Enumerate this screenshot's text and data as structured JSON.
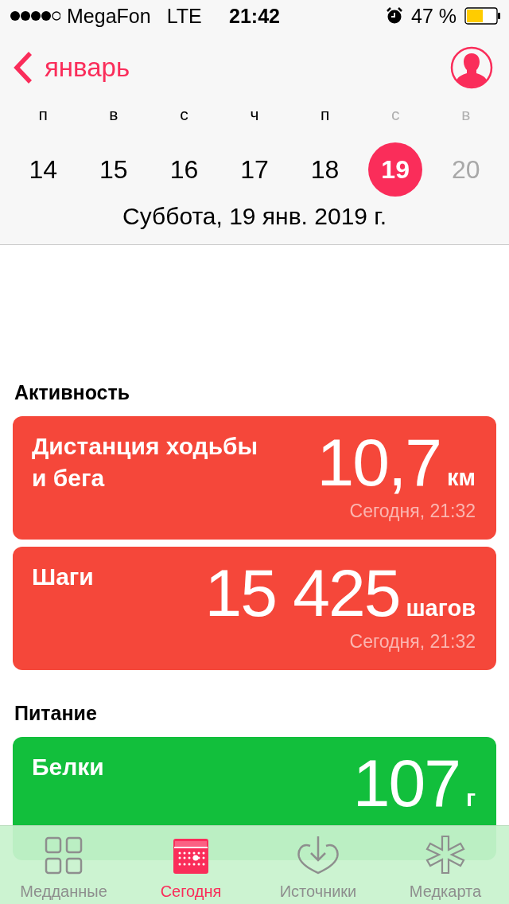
{
  "status_bar": {
    "carrier": "MegaFon",
    "network": "LTE",
    "time": "21:42",
    "battery": "47 %"
  },
  "nav": {
    "back": "январь"
  },
  "week": [
    {
      "letter": "п",
      "day": "14",
      "selected": false,
      "weekend": false
    },
    {
      "letter": "в",
      "day": "15",
      "selected": false,
      "weekend": false
    },
    {
      "letter": "с",
      "day": "16",
      "selected": false,
      "weekend": false
    },
    {
      "letter": "ч",
      "day": "17",
      "selected": false,
      "weekend": false
    },
    {
      "letter": "п",
      "day": "18",
      "selected": false,
      "weekend": false
    },
    {
      "letter": "с",
      "day": "19",
      "selected": true,
      "weekend": true
    },
    {
      "letter": "в",
      "day": "20",
      "selected": false,
      "weekend": true
    }
  ],
  "date": "Суббота, 19 янв. 2019 г.",
  "sections": [
    {
      "title": "Активность",
      "color": "#f5473a",
      "cards": [
        {
          "title": "Дистанция ходьбы и бега",
          "value": "10,7",
          "unit": "км",
          "time": "Сегодня, 21:32"
        },
        {
          "title": "Шаги",
          "value": "15 425",
          "unit": "шагов",
          "time": "Сегодня, 21:32"
        }
      ]
    },
    {
      "title": "Питание",
      "color": "#12bf3c",
      "cards": [
        {
          "title": "Белки",
          "value": "107",
          "unit": "г"
        }
      ]
    }
  ],
  "tabs": [
    {
      "label": "Медданные",
      "selected": false
    },
    {
      "label": "Сегодня",
      "selected": true
    },
    {
      "label": "Источники",
      "selected": false
    },
    {
      "label": "Медкарта",
      "selected": false
    }
  ]
}
